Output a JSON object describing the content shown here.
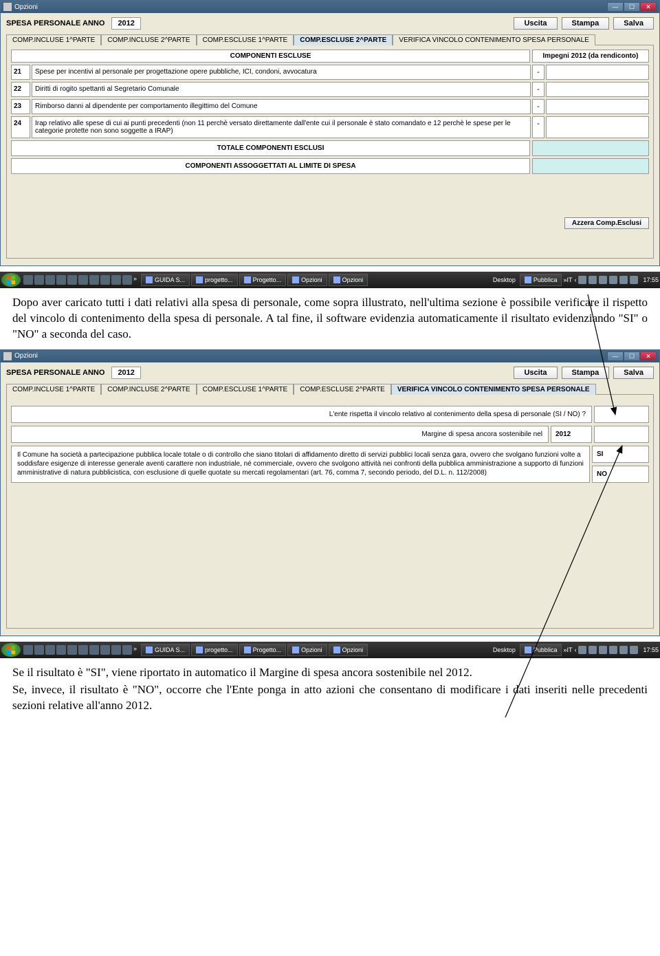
{
  "win1": {
    "title": "Opzioni",
    "header": {
      "label": "SPESA PERSONALE ANNO",
      "year": "2012"
    },
    "buttons": {
      "exit": "Uscita",
      "print": "Stampa",
      "save": "Salva"
    },
    "tabs": {
      "t1": "COMP.INCLUSE 1^PARTE",
      "t2": "COMP.INCLUSE 2^PARTE",
      "t3": "COMP.ESCLUSE 1^PARTE",
      "t4": "COMP.ESCLUSE 2^PARTE",
      "t5": "VERIFICA VINCOLO CONTENIMENTO SPESA PERSONALE"
    },
    "th": {
      "desc": "COMPONENTI ESCLUSE",
      "imp": "Impegni 2012 (da rendiconto)"
    },
    "rows": [
      {
        "n": "21",
        "d": "Spese per incentivi al personale per progettazione opere pubbliche, ICI, condoni, avvocatura",
        "s": "-"
      },
      {
        "n": "22",
        "d": "Diritti di rogito spettanti al Segretario Comunale",
        "s": "-"
      },
      {
        "n": "23",
        "d": "Rimborso danni al dipendente per comportamento illegittimo del Comune",
        "s": "-"
      },
      {
        "n": "24",
        "d": "Irap relativo alle spese di cui ai punti precedenti (non 11 perchè versato direttamente dall'ente cui il personale è stato comandato e 12 perchè le spese per le categorie protette non sono soggette a IRAP)",
        "s": "-"
      }
    ],
    "tot1": "TOTALE COMPONENTI ESCLUSI",
    "tot2": "COMPONENTI ASSOGGETTATI AL LIMITE DI SPESA",
    "azzera": "Azzera Comp.Esclusi"
  },
  "doc": {
    "p1": "Dopo aver caricato tutti i dati relativi alla spesa di personale, come sopra illustrato, nell'ultima sezione è possibile verificare il rispetto del vincolo di contenimento della spesa di personale. A tal fine, il software evidenzia automaticamente il risultato evidenziando \"SI\" o \"NO\" a seconda del caso.",
    "p2": "Se il risultato è \"SI\", viene riportato in automatico il Margine di spesa ancora sostenibile nel 2012.",
    "p3": "Se, invece, il risultato è \"NO\", occorre che l'Ente ponga in atto azioni che consentano di modificare i dati inseriti nelle precedenti sezioni relative all'anno 2012."
  },
  "win2": {
    "title": "Opzioni",
    "header": {
      "label": "SPESA PERSONALE ANNO",
      "year": "2012"
    },
    "buttons": {
      "exit": "Uscita",
      "print": "Stampa",
      "save": "Salva"
    },
    "tabs": {
      "t1": "COMP.INCLUSE 1^PARTE",
      "t2": "COMP.INCLUSE 2^PARTE",
      "t3": "COMP.ESCLUSE 1^PARTE",
      "t4": "COMP.ESCLUSE 2^PARTE",
      "t5": "VERIFICA VINCOLO CONTENIMENTO SPESA PERSONALE"
    },
    "q1": "L'ente rispetta il vincolo relativo al contenimento della spesa di personale (SI / NO) ?",
    "q2": "Margine di spesa ancora sostenibile nel",
    "q2year": "2012",
    "q3": "Il Comune ha società a partecipazione pubblica locale totale o di controllo che siano titolari di affidamento diretto di servizi pubblici locali senza gara, ovvero che svolgano funzioni volte a soddisfare esigenze di interesse generale aventi carattere non industriale, né commerciale, ovvero che svolgono attività nei confronti della pubblica amministrazione a supporto di funzioni amministrative di natura pubblicistica, con esclusione di quelle quotate su mercati regolamentari (art. 76, comma 7, secondo periodo, del D.L. n. 112/2008)",
    "si": "SI",
    "no": "NO"
  },
  "taskbar": {
    "tasks": [
      "GUIDA S...",
      "progetto...",
      "Progetto...",
      "Opzioni",
      "Opzioni"
    ],
    "desktop": "Desktop",
    "pubblica": "Pubblica",
    "lang": "IT",
    "clock": "17:55"
  }
}
